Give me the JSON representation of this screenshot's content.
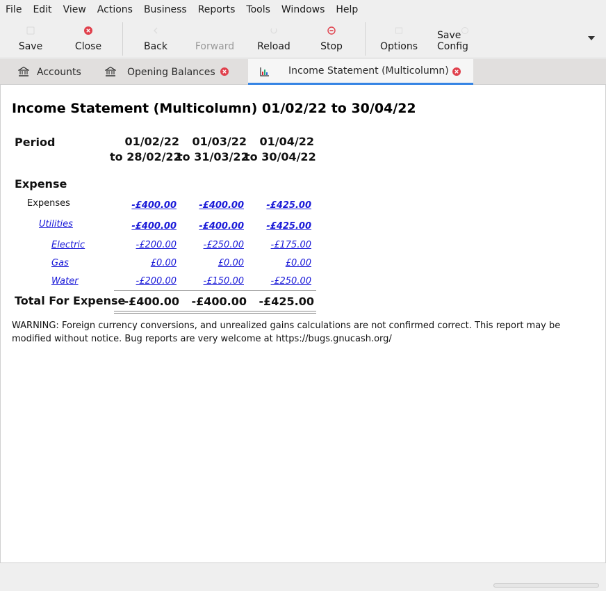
{
  "menubar": {
    "items": [
      "File",
      "Edit",
      "View",
      "Actions",
      "Business",
      "Reports",
      "Tools",
      "Windows",
      "Help"
    ]
  },
  "toolbar": {
    "save": "Save",
    "close": "Close",
    "back": "Back",
    "forward": "Forward",
    "reload": "Reload",
    "stop": "Stop",
    "options": "Options",
    "save_config": "Save Config"
  },
  "tabs": [
    {
      "label": "Accounts",
      "icon": "bank-icon",
      "closable": false,
      "active": false
    },
    {
      "label": "Opening Balances",
      "icon": "bank-icon",
      "closable": true,
      "active": false
    },
    {
      "label": "Income Statement (Multicolumn)",
      "icon": "chart-icon",
      "closable": true,
      "active": true
    }
  ],
  "report": {
    "title": "Income Statement (Multicolumn) 01/02/22 to 30/04/22",
    "period_label": "Period",
    "columns": [
      {
        "from": "01/02/22",
        "to": "to 28/02/22"
      },
      {
        "from": "01/03/22",
        "to": "to 31/03/22"
      },
      {
        "from": "01/04/22",
        "to": "to 30/04/22"
      }
    ],
    "section_label": "Expense",
    "rows": [
      {
        "label": "Expenses",
        "indent": 0,
        "link": false,
        "bold_values": true,
        "values": [
          "-£400.00",
          "-£400.00",
          "-£425.00"
        ]
      },
      {
        "label": "Utilities",
        "indent": 1,
        "link": true,
        "bold_values": true,
        "values": [
          "-£400.00",
          "-£400.00",
          "-£425.00"
        ]
      },
      {
        "label": "Electric",
        "indent": 2,
        "link": true,
        "bold_values": false,
        "values": [
          "-£200.00",
          "-£250.00",
          "-£175.00"
        ]
      },
      {
        "label": "Gas",
        "indent": 2,
        "link": true,
        "bold_values": false,
        "values": [
          "£0.00",
          "£0.00",
          "£0.00"
        ]
      },
      {
        "label": "Water",
        "indent": 2,
        "link": true,
        "bold_values": false,
        "values": [
          "-£200.00",
          "-£150.00",
          "-£250.00"
        ]
      }
    ],
    "total_label": "Total For Expense",
    "totals": [
      "-£400.00",
      "-£400.00",
      "-£425.00"
    ],
    "warning": "WARNING: Foreign currency conversions, and unrealized gains calculations are not confirmed correct. This report may be modified without notice. Bug reports are very welcome at https://bugs.gnucash.org/"
  },
  "colors": {
    "link": "#1a1ad8",
    "accent": "#3584e4",
    "close_red": "#e0404c"
  }
}
